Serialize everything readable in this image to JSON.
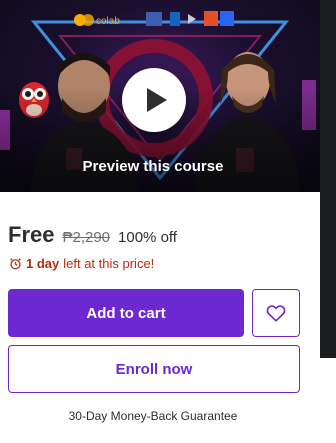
{
  "preview": {
    "label": "Preview this course",
    "logos": [
      "colab"
    ]
  },
  "pricing": {
    "price": "Free",
    "original_price": "₱2,290",
    "discount": "100% off"
  },
  "timer": {
    "bold": "1 day",
    "rest": "left at this price!"
  },
  "actions": {
    "add_to_cart": "Add to cart",
    "enroll": "Enroll now"
  },
  "guarantee": "30-Day Money-Back Guarantee",
  "colors": {
    "accent": "#6d28d2",
    "timer": "#b32d0f",
    "text": "#2d2f31"
  },
  "icons": {
    "play": "play-icon",
    "wishlist": "heart-icon",
    "timer": "alarm-clock-icon"
  }
}
